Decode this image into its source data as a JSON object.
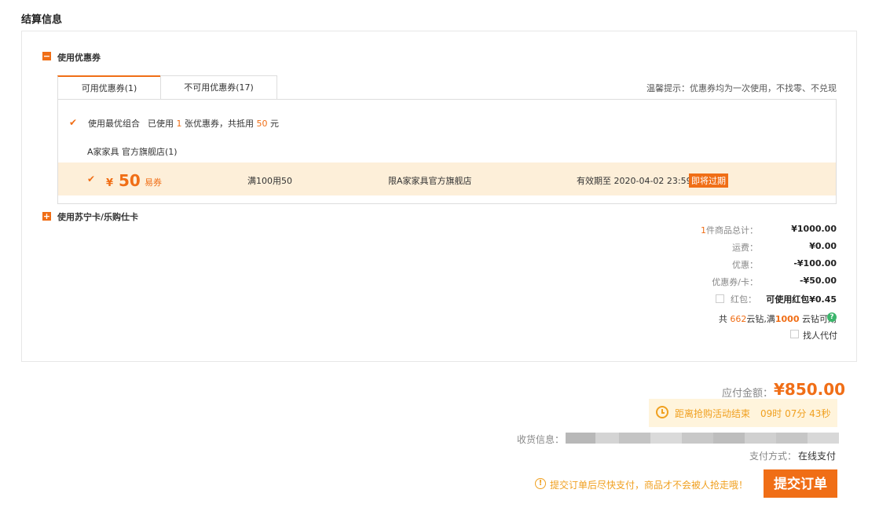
{
  "page": {
    "title": "结算信息"
  },
  "coupon_section": {
    "label": "使用优惠券",
    "collapse_symbol": "−",
    "tabs": [
      {
        "label": "可用优惠券(1)"
      },
      {
        "label": "不可用优惠券(17)"
      }
    ],
    "hint": "温馨提示：优惠券均为一次使用，不找零、不兑现",
    "best_combo_label": "使用最优组合",
    "used_text_pre": "已使用 ",
    "used_count": "1",
    "used_text_mid": " 张优惠券，共抵用 ",
    "used_amount": "50",
    "used_text_post": " 元",
    "store_name": "A家家具 官方旗舰店(1)",
    "coupon": {
      "currency": "¥",
      "amount": "50",
      "type": "易券",
      "condition": "满100用50",
      "scope": "限A家家具官方旗舰店",
      "validity": "有效期至 2020-04-02 23:59",
      "badge": "即将过期"
    }
  },
  "card_section": {
    "label": "使用苏宁卡/乐购仕卡",
    "expand_symbol": "+"
  },
  "summary": {
    "item_count": "1",
    "items_label": "件商品总计：",
    "items_total": "¥1000.00",
    "shipping_label": "运费：",
    "shipping": "¥0.00",
    "discount_label": "优惠：",
    "discount": "-¥100.00",
    "coupon_label": "优惠券/卡：",
    "coupon": "-¥50.00",
    "redpacket_label": "红包：",
    "redpacket": "可使用红包¥0.45",
    "diamond_pre": "共 ",
    "diamond_count": "662",
    "diamond_mid": "云钻,满",
    "diamond_threshold": "1000",
    "diamond_post": " 云钻可用",
    "proxy_pay_label": "找人代付"
  },
  "footer": {
    "payable_label": "应付金额：",
    "payable_amount": "¥850.00",
    "countdown_text": "距离抢购活动结束",
    "countdown_time": "09时 07分 43秒",
    "address_label": "收货信息：",
    "payment_label": "支付方式：",
    "payment_method": "在线支付",
    "warning": "提交订单后尽快支付，商品才不会被人抢走哦！",
    "submit_label": "提交订单"
  },
  "colors": {
    "accent": "#f06e16",
    "highlight_bg": "#fdefd9",
    "countdown": "#f0a020"
  }
}
